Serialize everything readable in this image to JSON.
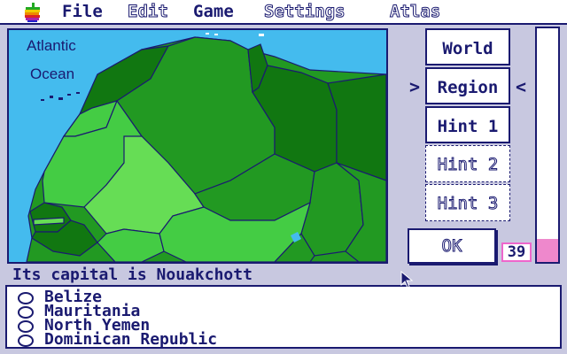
{
  "menu": {
    "apple_icon": "rainbow-apple-icon",
    "file": "File",
    "edit": "Edit",
    "game": "Game",
    "settings": "Settings",
    "atlas": "Atlas"
  },
  "map": {
    "label_line1": "Atlantic",
    "label_line2": "Ocean",
    "colors": {
      "water": "#44bbee",
      "dark": "#117711",
      "mid": "#229922",
      "light": "#44cc44",
      "pale": "#66dd55",
      "border": "#1a1a70"
    }
  },
  "buttons": {
    "world": "World",
    "region": "Region",
    "hint1": "Hint 1",
    "hint2": "Hint 2",
    "hint3": "Hint 3",
    "ok": "OK",
    "arrow_left": ">",
    "arrow_right": "<"
  },
  "score": "39",
  "timer_level": 0.1,
  "prompt": "Its capital is Nouakchott",
  "answers": [
    "Belize",
    "Mauritania",
    "North Yemen",
    "Dominican Republic"
  ],
  "colors": {
    "background": "#c8c8e0",
    "ink": "#1a1a70",
    "pink": "#ee88cc"
  }
}
